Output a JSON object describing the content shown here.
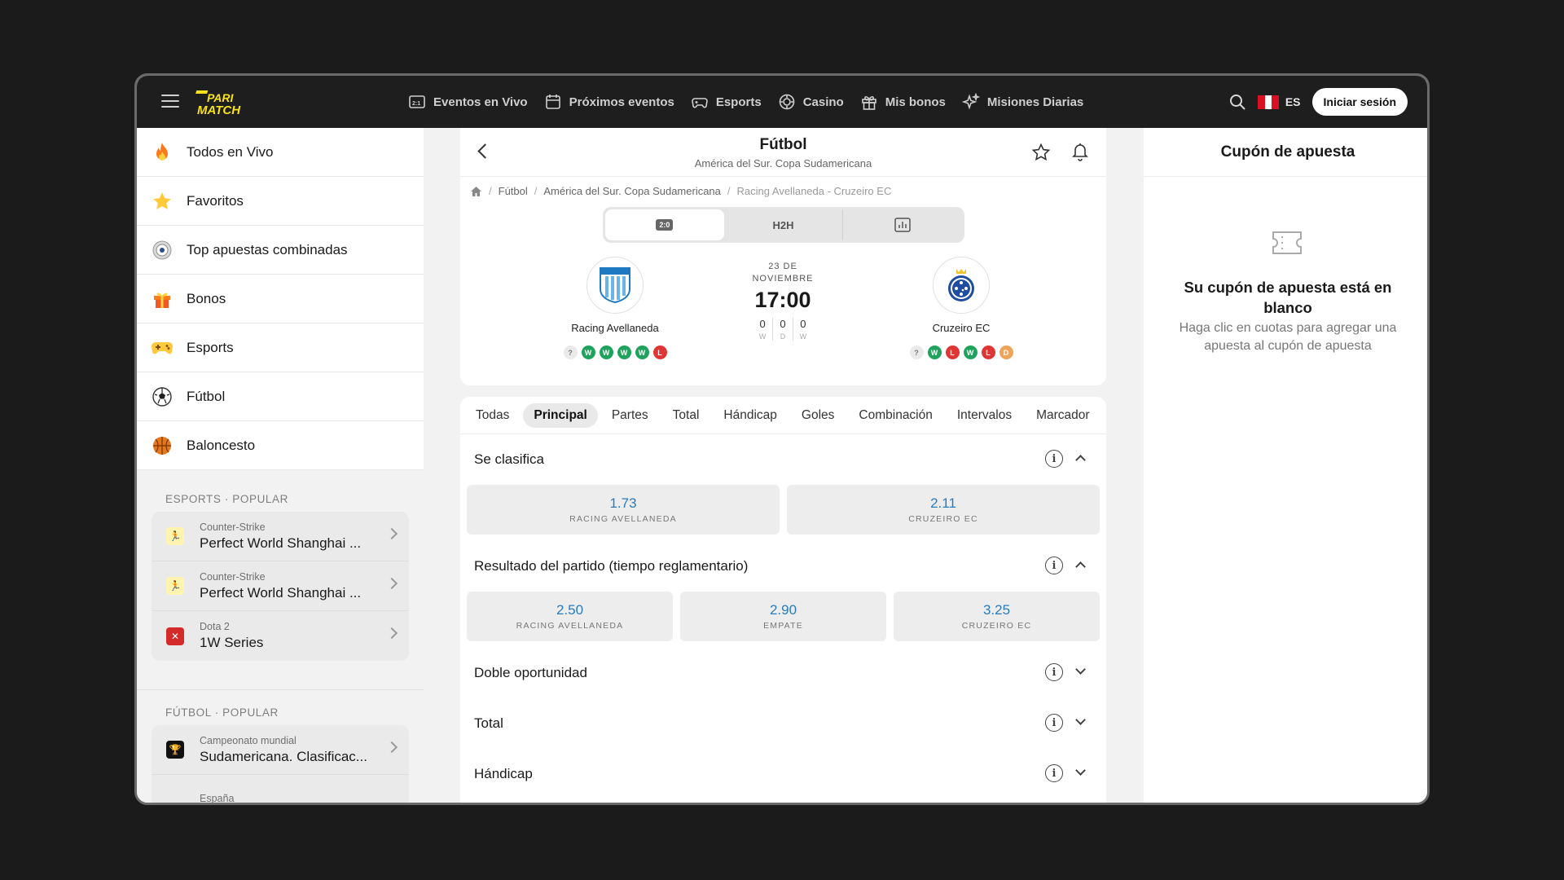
{
  "header": {
    "nav": [
      {
        "label": "Eventos en Vivo",
        "icon": "live-events-icon"
      },
      {
        "label": "Próximos eventos",
        "icon": "calendar-icon"
      },
      {
        "label": "Esports",
        "icon": "gamepad-icon"
      },
      {
        "label": "Casino",
        "icon": "casino-chip-icon"
      },
      {
        "label": "Mis bonos",
        "icon": "gift-icon"
      },
      {
        "label": "Misiones Diarias",
        "icon": "sparkle-icon"
      }
    ],
    "lang": "ES",
    "login_label": "Iniciar sesión",
    "logo_color": "#f7e11b"
  },
  "sidebar": {
    "items": [
      {
        "label": "Todos en Vivo",
        "icon": "fire-icon"
      },
      {
        "label": "Favoritos",
        "icon": "star-icon"
      },
      {
        "label": "Top apuestas combinadas",
        "icon": "target-icon"
      },
      {
        "label": "Bonos",
        "icon": "gift-icon"
      },
      {
        "label": "Esports",
        "icon": "gamepad-icon"
      },
      {
        "label": "Fútbol",
        "icon": "soccer-ball-icon"
      },
      {
        "label": "Baloncesto",
        "icon": "basketball-icon"
      }
    ],
    "esports_title": "ESPORTS · POPULAR",
    "esports": [
      {
        "sub": "Counter-Strike",
        "main": "Perfect World Shanghai ..."
      },
      {
        "sub": "Counter-Strike",
        "main": "Perfect World Shanghai ..."
      },
      {
        "sub": "Dota 2",
        "main": "1W Series"
      }
    ],
    "football_title": "FÚTBOL · POPULAR",
    "football": [
      {
        "sub": "Campeonato mundial",
        "main": "Sudamericana. Clasificac..."
      },
      {
        "sub": "España",
        "main": ""
      }
    ]
  },
  "match": {
    "title": "Fútbol",
    "subtitle": "América del Sur. Copa Sudamericana",
    "breadcrumb": [
      "Fútbol",
      "América del Sur. Copa Sudamericana",
      "Racing Avellaneda - Cruzeiro EC"
    ],
    "seg": [
      "2:0",
      "H2H"
    ],
    "date_line1": "23 DE",
    "date_line2": "NOVIEMBRE",
    "time": "17:00",
    "score": [
      {
        "v": "0",
        "l": "W"
      },
      {
        "v": "0",
        "l": "D"
      },
      {
        "v": "0",
        "l": "W"
      }
    ],
    "home": {
      "name": "Racing Avellaneda",
      "form": [
        "?",
        "W",
        "W",
        "W",
        "W",
        "L"
      ]
    },
    "away": {
      "name": "Cruzeiro EC",
      "form": [
        "?",
        "W",
        "L",
        "W",
        "L",
        "D"
      ]
    }
  },
  "markets": {
    "tabs": [
      "Todas",
      "Principal",
      "Partes",
      "Total",
      "Hándicap",
      "Goles",
      "Combinación",
      "Intervalos",
      "Marcador"
    ],
    "active_tab": "Principal",
    "groups": [
      {
        "title": "Se clasifica",
        "open": true,
        "odds": [
          {
            "val": "1.73",
            "cap": "RACING AVELLANEDA"
          },
          {
            "val": "2.11",
            "cap": "CRUZEIRO EC"
          }
        ]
      },
      {
        "title": "Resultado del partido (tiempo reglamentario)",
        "open": true,
        "odds": [
          {
            "val": "2.50",
            "cap": "RACING AVELLANEDA"
          },
          {
            "val": "2.90",
            "cap": "EMPATE"
          },
          {
            "val": "3.25",
            "cap": "CRUZEIRO EC"
          }
        ]
      },
      {
        "title": "Doble oportunidad",
        "open": false
      },
      {
        "title": "Total",
        "open": false
      },
      {
        "title": "Hándicap",
        "open": false
      }
    ],
    "odds_color": "#2a7bbd"
  },
  "coupon": {
    "title": "Cupón de apuesta",
    "empty_title": "Su cupón de apuesta está en blanco",
    "empty_text": "Haga clic en cuotas para agregar una apuesta al cupón de apuesta"
  }
}
